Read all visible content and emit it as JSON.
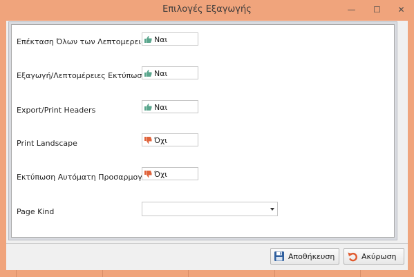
{
  "window": {
    "title": "Επιλογές Εξαγωγής",
    "minimize_glyph": "—",
    "maximize_glyph": "☐",
    "close_glyph": "✕"
  },
  "colors": {
    "window_frame": "#f0a47c",
    "yes_icon": "#5aa68d",
    "no_icon": "#e0643c",
    "save_icon": "#2f5f9e",
    "cancel_icon": "#e05a2e"
  },
  "options": [
    {
      "label": "Επέκταση Όλων των Λεπτομερειών",
      "value": "Ναι",
      "icon": "thumbs-up-icon"
    },
    {
      "label": "Εξαγωγή/Λεπτομέρειες Εκτύπωσης",
      "value": "Ναι",
      "icon": "thumbs-up-icon"
    },
    {
      "label": "Export/Print Headers",
      "value": "Ναι",
      "icon": "thumbs-up-icon"
    },
    {
      "label": "Print Landscape",
      "value": "Όχι",
      "icon": "thumbs-down-icon"
    },
    {
      "label": "Εκτύπωση Αυτόματη Προσαρμογή",
      "value": "Όχι",
      "icon": "thumbs-down-icon"
    }
  ],
  "page_kind": {
    "label": "Page Kind",
    "value": ""
  },
  "buttons": {
    "save_label": "Αποθήκευση",
    "cancel_label": "Ακύρωση"
  }
}
